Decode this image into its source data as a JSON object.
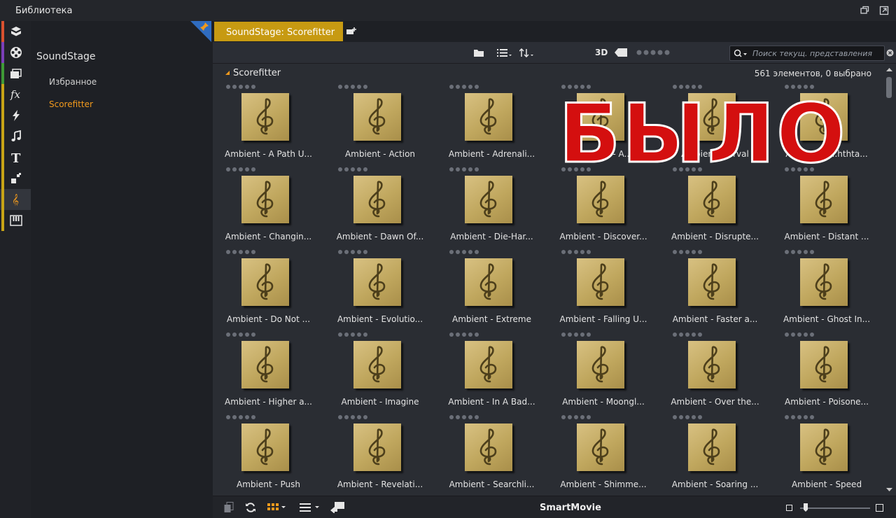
{
  "window": {
    "title": "Библиотека"
  },
  "colors": {
    "accent": "#f29a1d",
    "tab": "#c79a12",
    "pin": "#2f6cc0",
    "stamp": "#d40f0f"
  },
  "rail": [
    {
      "icon": "package-icon",
      "color": "#d9512f"
    },
    {
      "icon": "film-reel-icon",
      "color": "#7b3fb8"
    },
    {
      "icon": "clips-icon",
      "color": "#3f9a36"
    },
    {
      "icon": "fx-icon",
      "color": "#c8a416"
    },
    {
      "icon": "lightning-icon",
      "color": "#c8a416"
    },
    {
      "icon": "music-note-icon",
      "color": "#c8a416"
    },
    {
      "icon": "text-icon",
      "color": "#c8a416"
    },
    {
      "icon": "transition-icon",
      "color": "#c8a416"
    },
    {
      "icon": "treble-clef-icon",
      "color": "#c8a416"
    },
    {
      "icon": "piano-icon",
      "color": "#c8a416"
    }
  ],
  "tree": {
    "root": "SoundStage",
    "items": [
      "Избранное",
      "Scorefitter"
    ]
  },
  "tab": {
    "label": "SoundStage: Scorefitter"
  },
  "toolbar": {
    "mode_3d": "3D",
    "search_placeholder": "Поиск текущ. представления",
    "rating": 0
  },
  "grid": {
    "title": "Scorefitter",
    "count": "561 элементов, 0 выбрано",
    "tiles": [
      "Ambient - A Path U...",
      "Ambient - Action",
      "Ambient - Adrenali...",
      "Ambient - A...",
      "Ambient - ...rval",
      "Ambient - ...hthta...",
      "Ambient - Changin...",
      "Ambient - Dawn Of...",
      "Ambient - Die-Har...",
      "Ambient - Discover...",
      "Ambient - Disrupte...",
      "Ambient - Distant ...",
      "Ambient - Do Not ...",
      "Ambient - Evolutio...",
      "Ambient - Extreme",
      "Ambient - Falling U...",
      "Ambient - Faster a...",
      "Ambient - Ghost In...",
      "Ambient - Higher a...",
      "Ambient - Imagine",
      "Ambient - In A Bad...",
      "Ambient - Moongl...",
      "Ambient - Over the...",
      "Ambient - Poisone...",
      "Ambient - Push",
      "Ambient - Revelati...",
      "Ambient - Searchli...",
      "Ambient - Shimme...",
      "Ambient - Soaring ...",
      "Ambient - Speed"
    ]
  },
  "bottom": {
    "brand": "SmartMovie"
  },
  "stamp": {
    "text": "БЫЛО"
  }
}
